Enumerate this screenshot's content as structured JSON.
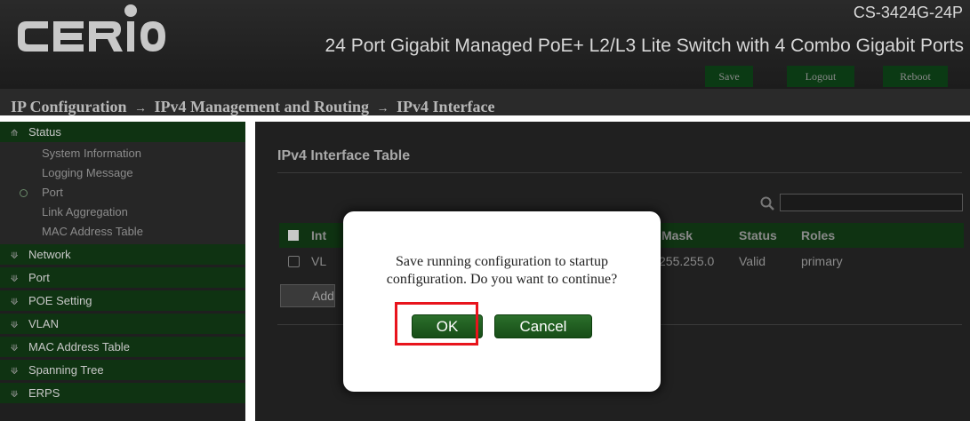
{
  "header": {
    "logo_text": "CERIO",
    "model": "CS-3424G-24P",
    "subtitle": "24 Port Gigabit Managed PoE+ L2/L3 Lite Switch with 4 Combo Gigabit Ports",
    "buttons": {
      "save": "Save",
      "logout": "Logout",
      "reboot": "Reboot"
    }
  },
  "breadcrumb": {
    "items": [
      "IP Configuration",
      "IPv4 Management and Routing",
      "IPv4 Interface"
    ],
    "separator": "→"
  },
  "sidebar": {
    "status": {
      "label": "Status",
      "items": [
        "System Information",
        "Logging Message",
        "Port",
        "Link Aggregation",
        "MAC Address Table"
      ]
    },
    "sections": [
      "Network",
      "Port",
      "POE Setting",
      "VLAN",
      "MAC Address Table",
      "Spanning Tree",
      "ERPS"
    ]
  },
  "content": {
    "title": "IPv4 Interface Table",
    "table": {
      "headers": {
        "interface": "Int",
        "mask": "Mask",
        "status": "Status",
        "roles": "Roles"
      },
      "row": {
        "interface": "VL",
        "mask": "255.255.0",
        "status": "Valid",
        "roles": "primary"
      }
    },
    "add_label": "Add"
  },
  "dialog": {
    "message_line1": "Save running configuration to startup",
    "message_line2": "configuration. Do you want to continue?",
    "ok_label": "OK",
    "cancel_label": "Cancel"
  },
  "colors": {
    "accent_green": "#0f3312",
    "button_green": "#1f5e1f",
    "highlight_red": "#e8141c"
  }
}
